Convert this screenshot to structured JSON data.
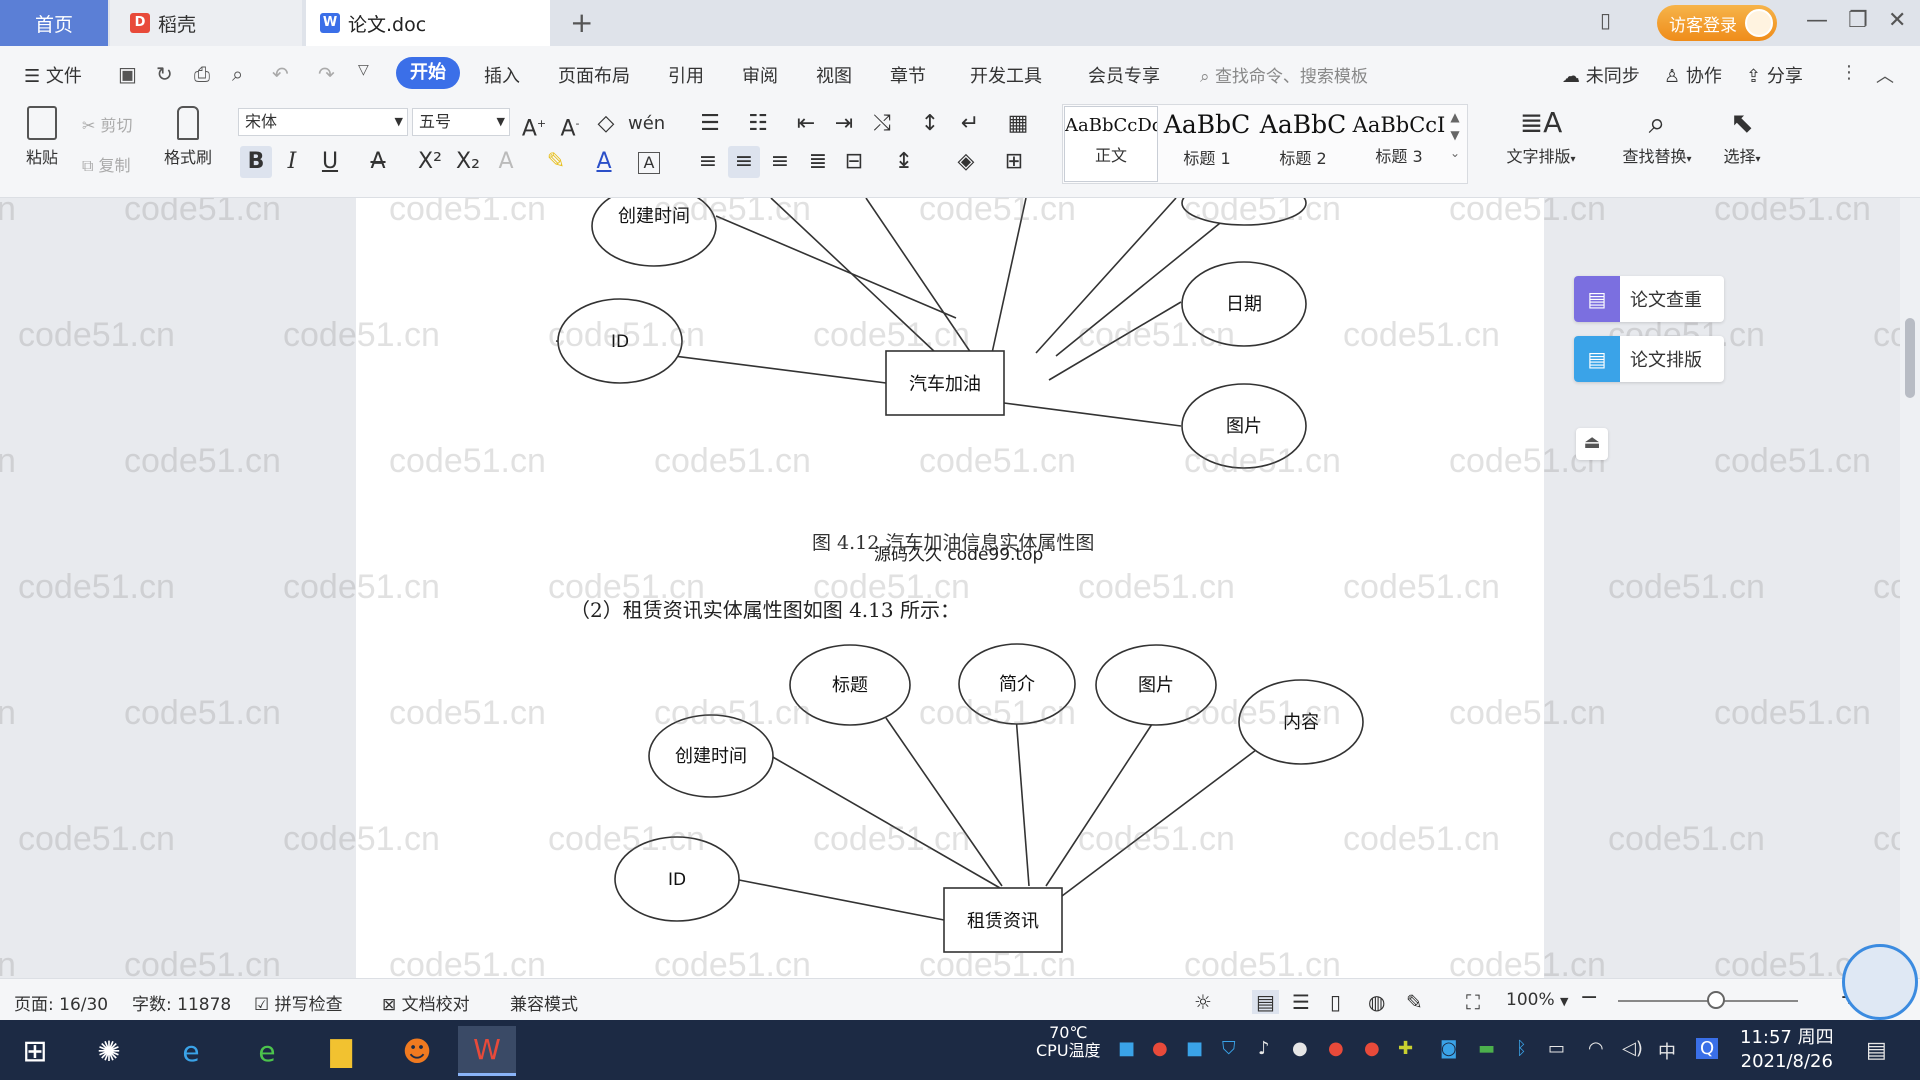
{
  "tabs": {
    "home": "首页",
    "daoke": "稻壳",
    "doc": "论文.doc",
    "add": "+"
  },
  "login": "访客登录",
  "menu": {
    "file": "文件",
    "items": [
      "开始",
      "插入",
      "页面布局",
      "引用",
      "审阅",
      "视图",
      "章节",
      "开发工具",
      "会员专享"
    ],
    "search": "查找命令、搜索模板",
    "sync": "未同步",
    "collab": "协作",
    "share": "分享"
  },
  "ribbon": {
    "paste": "粘贴",
    "cut": "剪切",
    "copy": "复制",
    "format_painter": "格式刷",
    "font_name": "宋体",
    "font_size": "五号",
    "styles": [
      {
        "sample": "AaBbCcDd",
        "label": "正文"
      },
      {
        "sample": "AaBbC",
        "label": "标题 1"
      },
      {
        "sample": "AaBbC",
        "label": "标题 2"
      },
      {
        "sample": "AaBbCcI",
        "label": "标题 3"
      }
    ],
    "text_layout": "文字排版",
    "find_replace": "查找替换",
    "select": "选择"
  },
  "document": {
    "diagram1": {
      "center": "汽车加油",
      "attrs": [
        "创建时间",
        "ID",
        "日期",
        "图片"
      ]
    },
    "caption1": "图 4.12 汽车加油信息实体属性图",
    "overlay": "源码久久 code99.top",
    "paragraph": "（2）租赁资讯实体属性图如图 4.13 所示：",
    "diagram2": {
      "center": "租赁资讯",
      "attrs": [
        "标题",
        "简介",
        "图片",
        "内容",
        "创建时间",
        "ID"
      ]
    },
    "watermark": "code51.cn"
  },
  "side_panel": {
    "check": "论文查重",
    "layout": "论文排版"
  },
  "status": {
    "page": "页面: 16/30",
    "words": "字数: 11878",
    "spell": "拼写检查",
    "proof": "文档校对",
    "compat": "兼容模式",
    "zoom": "100%"
  },
  "taskbar": {
    "cpu_temp": "70℃",
    "cpu_label": "CPU温度",
    "time": "11:57 周四",
    "date": "2021/8/26",
    "ime": "中"
  },
  "colors": {
    "accent": "#3b6fe8",
    "home_tab": "#5b7fd6",
    "login": "#ef8c1a",
    "check_icon": "#7b6fe0",
    "layout_icon": "#3aa3e8"
  }
}
